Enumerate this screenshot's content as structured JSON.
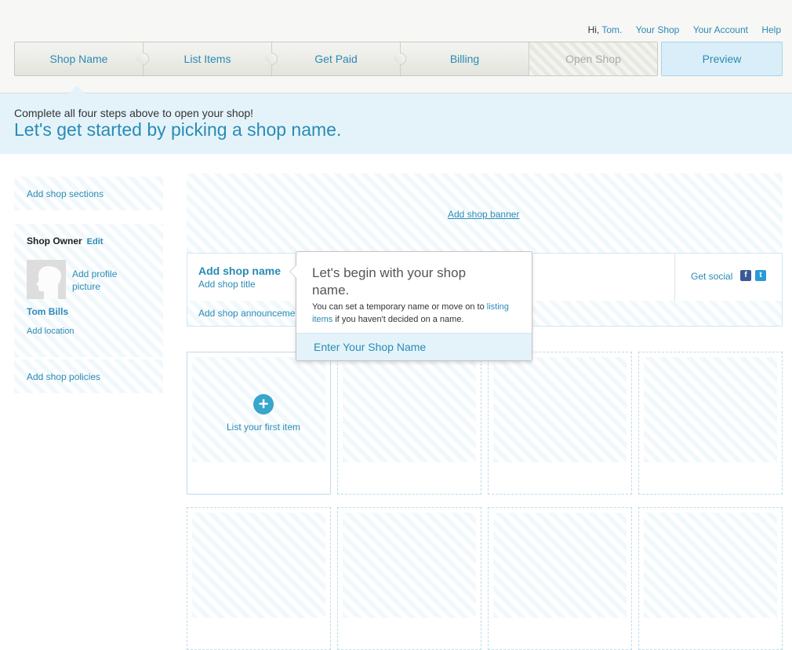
{
  "top_links": {
    "greeting_prefix": "Hi,",
    "user": "Tom.",
    "your_shop": "Your Shop",
    "your_account": "Your Account",
    "help": "Help"
  },
  "steps": [
    {
      "label": "Shop Name",
      "state": "active"
    },
    {
      "label": "List Items",
      "state": "enabled"
    },
    {
      "label": "Get Paid",
      "state": "enabled"
    },
    {
      "label": "Billing",
      "state": "enabled"
    },
    {
      "label": "Open Shop",
      "state": "disabled"
    }
  ],
  "preview_label": "Preview",
  "intro": {
    "subtitle": "Complete all four steps above to open your shop!",
    "headline": "Let's get started by picking a shop name."
  },
  "sidebar": {
    "add_sections": "Add shop sections",
    "owner_heading": "Shop Owner",
    "edit": "Edit",
    "add_picture": "Add profile picture",
    "owner_name": "Tom Bills",
    "add_location": "Add location",
    "add_policies": "Add shop policies"
  },
  "shop": {
    "add_banner": "Add shop banner",
    "add_name": "Add shop name",
    "add_title": "Add shop title",
    "get_social": "Get social",
    "announcement": "Add shop announcement",
    "list_first_item": "List your first item"
  },
  "popover": {
    "title": "Let's begin with your shop name.",
    "desc_prefix": "You can set a temporary name or move on to",
    "desc_link": "listing items",
    "desc_suffix": "if you haven't decided on a name.",
    "input_placeholder": "Enter Your Shop Name"
  },
  "colors": {
    "accent": "#2a8bb3",
    "info_bg": "#e4f3fa",
    "preview_bg": "#d9eef8"
  }
}
